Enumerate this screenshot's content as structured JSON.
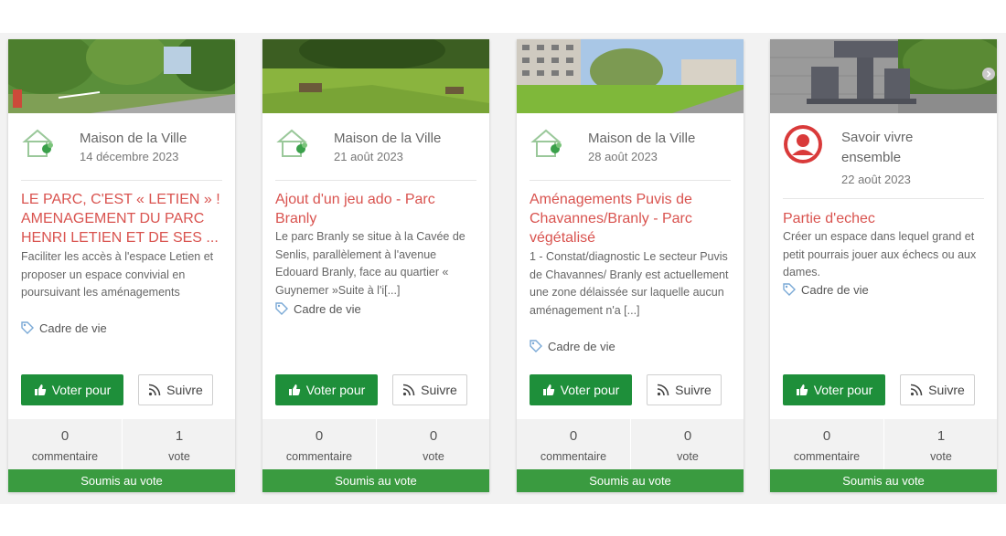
{
  "cards": [
    {
      "author": "Maison de la Ville",
      "date": "14 décembre 2023",
      "title": "LE PARC, C'EST « LETIEN » ! AMENAGEMENT DU PARC HENRI LETIEN ET DE SES ...",
      "description": "Faciliter les accès à l'espace Letien et proposer un espace convivial en poursuivant les aménagements",
      "tag": "Cadre de vie",
      "vote_button": "Voter pour",
      "follow_button": "Suivre",
      "comments_count": "0",
      "comments_label": "commentaire",
      "votes_count": "1",
      "votes_label": "vote",
      "status": "Soumis au vote"
    },
    {
      "author": "Maison de la Ville",
      "date": "21 août 2023",
      "title": "Ajout d'un jeu ado - Parc Branly",
      "description": "Le parc Branly se situe à la Cavée de Senlis, parallèlement à l'avenue Edouard Branly, face au quartier « Guynemer »Suite à l'i[...]",
      "tag": "Cadre de vie",
      "vote_button": "Voter pour",
      "follow_button": "Suivre",
      "comments_count": "0",
      "comments_label": "commentaire",
      "votes_count": "0",
      "votes_label": "vote",
      "status": "Soumis au vote"
    },
    {
      "author": "Maison de la Ville",
      "date": "28 août 2023",
      "title": "Aménagements Puvis de Chavannes/Branly - Parc végétalisé",
      "description": "1 - Constat/diagnostic Le secteur Puvis de Chavannes/ Branly est actuellement une zone délaissée sur laquelle aucun aménagement n'a [...]",
      "tag": "Cadre de vie",
      "vote_button": "Voter pour",
      "follow_button": "Suivre",
      "comments_count": "0",
      "comments_label": "commentaire",
      "votes_count": "0",
      "votes_label": "vote",
      "status": "Soumis au vote"
    },
    {
      "author": "Savoir vivre ensemble",
      "date": "22 août 2023",
      "title": "Partie d'echec",
      "description": "Créer un espace dans lequel grand et petit pourrais jouer aux échecs ou aux dames.",
      "tag": "Cadre de vie",
      "vote_button": "Voter pour",
      "follow_button": "Suivre",
      "comments_count": "0",
      "comments_label": "commentaire",
      "votes_count": "1",
      "votes_label": "vote",
      "status": "Soumis au vote"
    }
  ],
  "colors": {
    "title": "#d9534f",
    "vote_button": "#1e8f3a",
    "status_bar": "#3a9b40",
    "stats_background": "#f2f2f2",
    "avatar_red": "#d93a3a"
  },
  "icons": {
    "author_org": "house-logo-icon",
    "author_user": "user-avatar-icon",
    "tag": "tag-icon",
    "vote": "thumbs-up-icon",
    "follow": "rss-icon",
    "carousel_next": "chevron-right-icon"
  }
}
